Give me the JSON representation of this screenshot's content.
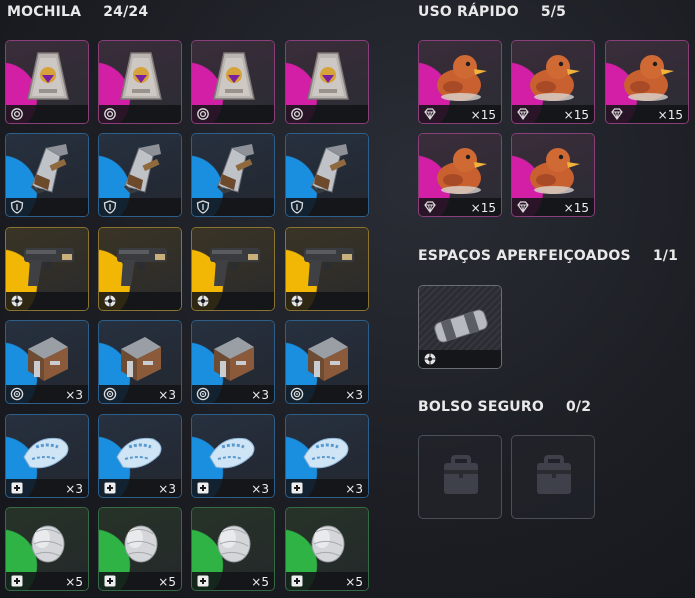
{
  "backpack": {
    "title": "MOCHILA",
    "count": "24/24",
    "rows": [
      {
        "item": "pouch",
        "rarity": "pink",
        "badge": "fingerprint-icon",
        "qty": ""
      },
      {
        "item": "jetpack",
        "rarity": "blue",
        "badge": "shield-icon",
        "qty": ""
      },
      {
        "item": "pistol",
        "rarity": "yellow",
        "badge": "aperture-icon",
        "qty": ""
      },
      {
        "item": "crate",
        "rarity": "blue",
        "badge": "target-icon",
        "qty": "×3"
      },
      {
        "item": "bandage",
        "rarity": "blue",
        "badge": "medkit-icon",
        "qty": "×3"
      },
      {
        "item": "wrap",
        "rarity": "green",
        "badge": "medkit-icon",
        "qty": "×5"
      }
    ]
  },
  "quick_use": {
    "title": "USO RÁPIDO",
    "count": "5/5",
    "items": [
      {
        "item": "rubber-duck",
        "rarity": "pink",
        "badge": "diamond-icon",
        "qty": "×15"
      },
      {
        "item": "rubber-duck",
        "rarity": "pink",
        "badge": "diamond-icon",
        "qty": "×15"
      },
      {
        "item": "rubber-duck",
        "rarity": "pink",
        "badge": "diamond-icon",
        "qty": "×15"
      },
      {
        "item": "rubber-duck",
        "rarity": "pink",
        "badge": "diamond-icon",
        "qty": "×15"
      },
      {
        "item": "rubber-duck",
        "rarity": "pink",
        "badge": "diamond-icon",
        "qty": "×15"
      }
    ]
  },
  "upgraded": {
    "title": "ESPAÇOS APERFEIÇOADOS",
    "count": "1/1",
    "item": {
      "item": "battery",
      "rarity": "grey",
      "badge": "aperture-icon",
      "qty": ""
    }
  },
  "safe_pocket": {
    "title": "BOLSO SEGURO",
    "count": "0/2",
    "slots": [
      "locked",
      "locked"
    ]
  },
  "colors": {
    "pink": "#d21fa5",
    "blue": "#1a8fe0",
    "yellow": "#f2b705",
    "green": "#2fb344"
  }
}
